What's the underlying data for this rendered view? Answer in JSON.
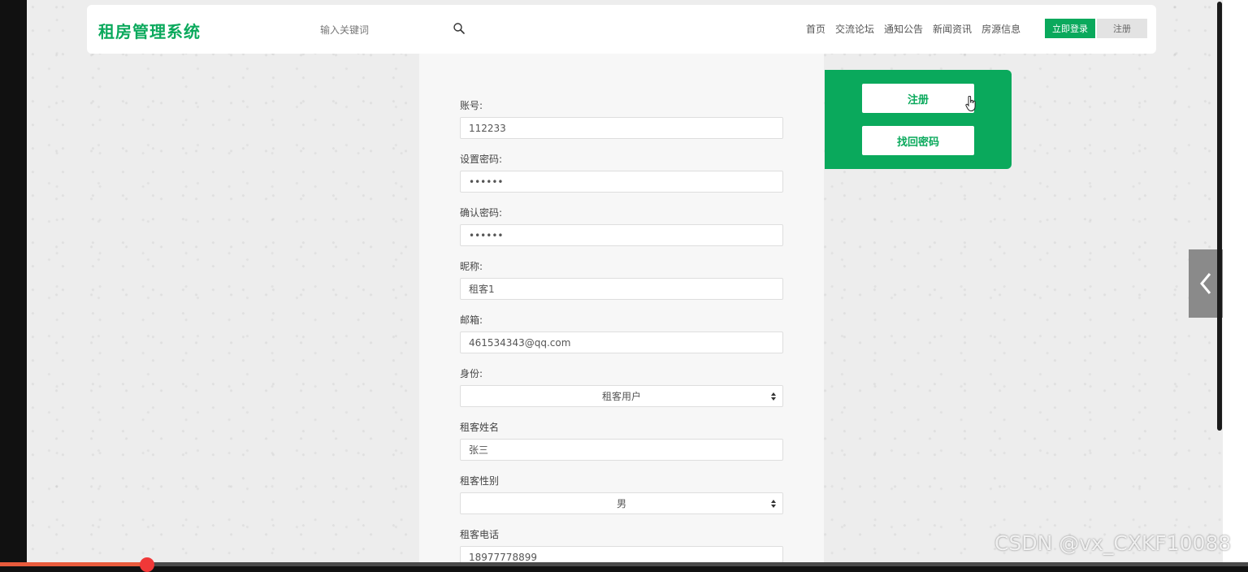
{
  "header": {
    "brand": "租房管理系统",
    "search_placeholder": "输入关键词",
    "nav": [
      "首页",
      "交流论坛",
      "通知公告",
      "新闻资讯",
      "房源信息"
    ],
    "login_button": "立即登录",
    "register_button": "注册"
  },
  "form": {
    "fields": [
      {
        "label": "账号:",
        "value": "112233",
        "type": "text"
      },
      {
        "label": "设置密码:",
        "value": "••••••",
        "type": "password"
      },
      {
        "label": "确认密码:",
        "value": "••••••",
        "type": "password"
      },
      {
        "label": "昵称:",
        "value": "租客1",
        "type": "text"
      },
      {
        "label": "邮箱:",
        "value": "461534343@qq.com",
        "type": "text"
      },
      {
        "label": "身份:",
        "value": "租客用户",
        "type": "select"
      },
      {
        "label": "租客姓名",
        "value": "张三",
        "type": "text"
      },
      {
        "label": "租客性别",
        "value": "男",
        "type": "select"
      },
      {
        "label": "租客电话",
        "value": "18977778899",
        "type": "text"
      }
    ]
  },
  "side_panel": {
    "register_button": "注册",
    "recover_button": "找回密码"
  },
  "watermark": "CSDN @vx_CXKF10088",
  "video": {
    "progress": 0.12
  },
  "colors": {
    "brand": "#0aa95c",
    "page_bg": "#ededed"
  }
}
